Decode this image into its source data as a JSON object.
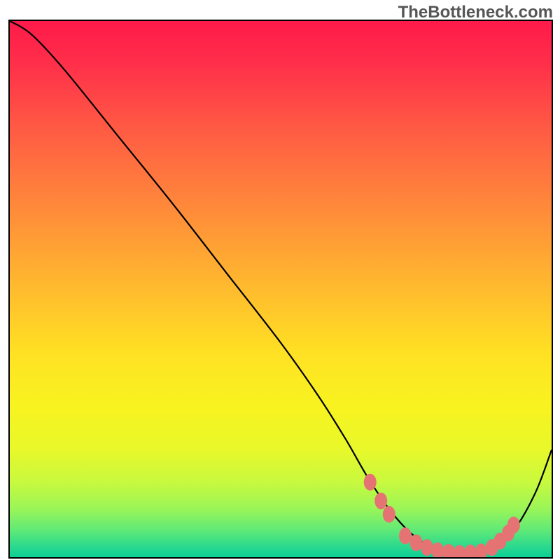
{
  "watermark": "TheBottleneck.com",
  "chart_data": {
    "type": "line",
    "title": "",
    "xlabel": "",
    "ylabel": "",
    "xlim": [
      0,
      100
    ],
    "ylim": [
      0,
      100
    ],
    "gradient_stops": [
      {
        "offset": 0,
        "color": "#ff1a4a"
      },
      {
        "offset": 0.08,
        "color": "#ff2f4a"
      },
      {
        "offset": 0.2,
        "color": "#ff5a44"
      },
      {
        "offset": 0.35,
        "color": "#ff8a3a"
      },
      {
        "offset": 0.5,
        "color": "#ffbb2e"
      },
      {
        "offset": 0.62,
        "color": "#ffe123"
      },
      {
        "offset": 0.72,
        "color": "#f8f320"
      },
      {
        "offset": 0.8,
        "color": "#e8f82a"
      },
      {
        "offset": 0.86,
        "color": "#c8f93e"
      },
      {
        "offset": 0.91,
        "color": "#9af558"
      },
      {
        "offset": 0.95,
        "color": "#5fe977"
      },
      {
        "offset": 0.98,
        "color": "#2bd98e"
      },
      {
        "offset": 1.0,
        "color": "#0bcf95"
      }
    ],
    "series": [
      {
        "name": "bottleneck-curve",
        "x": [
          0,
          4,
          10,
          20,
          30,
          40,
          50,
          57,
          62,
          66,
          70,
          74,
          78,
          82,
          86,
          89,
          93,
          97,
          100
        ],
        "y": [
          100,
          97.5,
          91,
          78.5,
          66,
          53,
          40,
          30,
          22,
          15,
          9,
          4.5,
          1.8,
          0.7,
          0.6,
          1.5,
          5,
          12,
          20
        ]
      }
    ],
    "markers": {
      "name": "highlight-points",
      "color": "#e57373",
      "points": [
        {
          "x": 66.5,
          "y": 14.0
        },
        {
          "x": 68.5,
          "y": 10.5
        },
        {
          "x": 70.0,
          "y": 8.0
        },
        {
          "x": 73.0,
          "y": 4.0
        },
        {
          "x": 75.0,
          "y": 2.7
        },
        {
          "x": 77.0,
          "y": 1.8
        },
        {
          "x": 79.0,
          "y": 1.2
        },
        {
          "x": 81.0,
          "y": 0.9
        },
        {
          "x": 83.0,
          "y": 0.7
        },
        {
          "x": 85.0,
          "y": 0.8
        },
        {
          "x": 87.0,
          "y": 1.0
        },
        {
          "x": 89.0,
          "y": 1.8
        },
        {
          "x": 90.5,
          "y": 3.0
        },
        {
          "x": 92.0,
          "y": 4.5
        },
        {
          "x": 93.0,
          "y": 6.0
        }
      ]
    }
  }
}
